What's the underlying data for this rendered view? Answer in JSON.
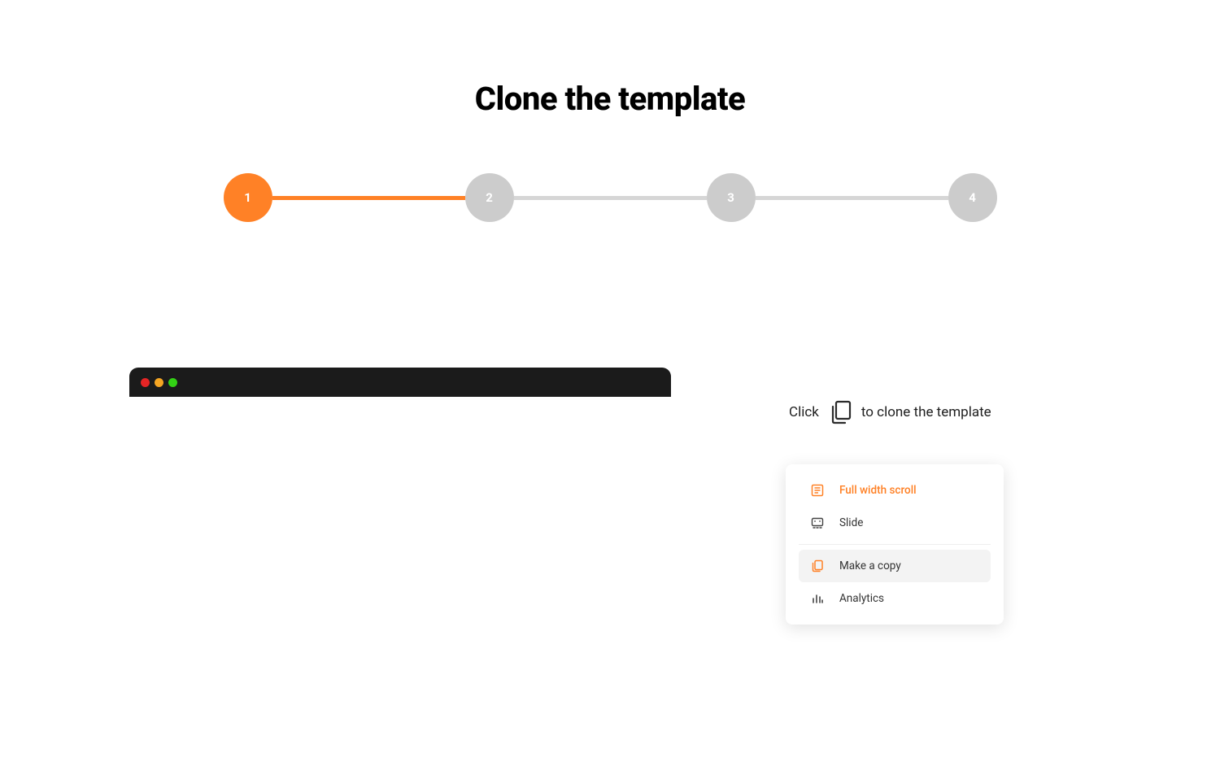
{
  "title": "Clone the template",
  "stepper": {
    "steps": [
      "1",
      "2",
      "3",
      "4"
    ],
    "active_index": 0
  },
  "instruction": {
    "prefix": "Click",
    "suffix": "to clone the template"
  },
  "menu": {
    "items": [
      {
        "label": "Full width scroll",
        "icon": "document-icon",
        "active": true,
        "highlighted": false
      },
      {
        "label": "Slide",
        "icon": "presentation-icon",
        "active": false,
        "highlighted": false
      },
      {
        "label": "Make a copy",
        "icon": "copy-outline-icon",
        "active": false,
        "highlighted": true
      },
      {
        "label": "Analytics",
        "icon": "bars-icon",
        "active": false,
        "highlighted": false
      }
    ]
  },
  "colors": {
    "accent": "#ff8126",
    "inactive": "#cccccc"
  }
}
